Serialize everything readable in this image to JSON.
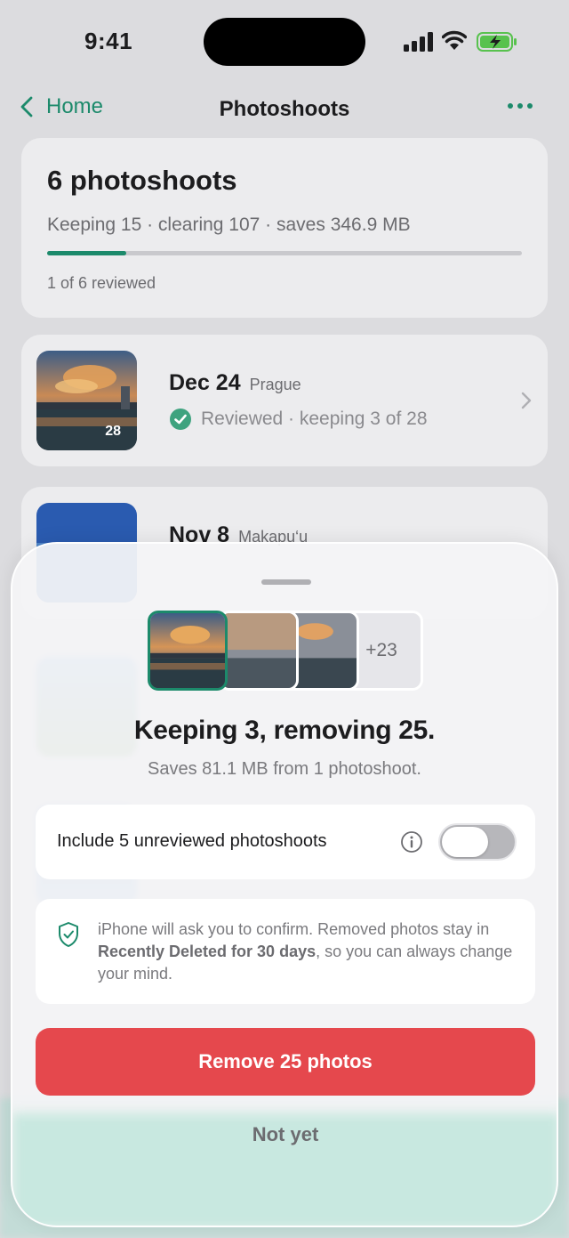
{
  "status_bar": {
    "time": "9:41"
  },
  "nav": {
    "back_label": "Home",
    "title": "Photoshoots"
  },
  "summary": {
    "title": "6 photoshoots",
    "subtitle": "Keeping 15 · clearing 107 · saves 346.9 MB",
    "reviewed_fraction": 0.167,
    "reviewed_text": "1 of 6 reviewed"
  },
  "shoots": [
    {
      "date": "Dec 24",
      "place": "Prague",
      "status": "Reviewed · keeping 3 of 28",
      "thumb_count": "28"
    },
    {
      "date": "Nov 8",
      "place": "Makapu‘u"
    }
  ],
  "sheet": {
    "more_count": "+23",
    "title": "Keeping 3, removing 25.",
    "subtitle": "Saves 81.1 MB from 1 photoshoot.",
    "toggle_label": "Include 5 unreviewed photoshoots",
    "toggle_on": false,
    "note_before": "iPhone will ask you to confirm. Removed photos stay in ",
    "note_bold": "Recently Deleted for 30 days",
    "note_after": ", so you can always change your mind.",
    "remove_label": "Remove 25 photos",
    "not_yet_label": "Not yet"
  },
  "colors": {
    "accent": "#1c8a6b",
    "danger": "#e5484d"
  },
  "icons": [
    "signal-icon",
    "wifi-icon",
    "battery-charging-icon",
    "chevron-left-icon",
    "more-icon",
    "check-circle-icon",
    "chevron-right-icon",
    "info-icon",
    "shield-check-icon"
  ]
}
